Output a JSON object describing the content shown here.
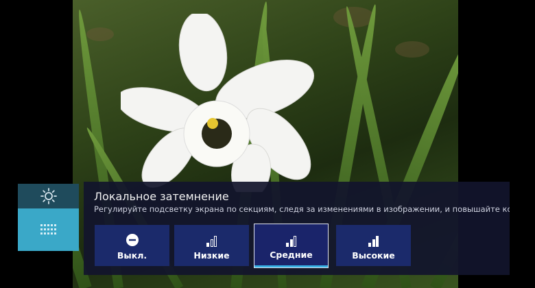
{
  "panel": {
    "title": "Локальное затемнение",
    "description": "Регулируйте подсветку экрана по секциям, следя за изменениями в изображении, и повышайте контр"
  },
  "options": [
    {
      "label": "Выкл.",
      "icon": "off-circle-icon",
      "selected": false
    },
    {
      "label": "Низкие",
      "icon": "level-low-icon",
      "selected": false
    },
    {
      "label": "Средние",
      "icon": "level-medium-icon",
      "selected": true
    },
    {
      "label": "Высокие",
      "icon": "level-high-icon",
      "selected": false
    }
  ],
  "side_menu": {
    "items": [
      {
        "icon": "brightness-sun-icon",
        "selected": false
      },
      {
        "icon": "local-dimming-grid-icon",
        "selected": true
      }
    ]
  },
  "colors": {
    "accent": "#39b3e6",
    "panel_bg": "#12142c",
    "option_bg": "#1b2a6b",
    "side_selected": "#3aa8c8"
  }
}
